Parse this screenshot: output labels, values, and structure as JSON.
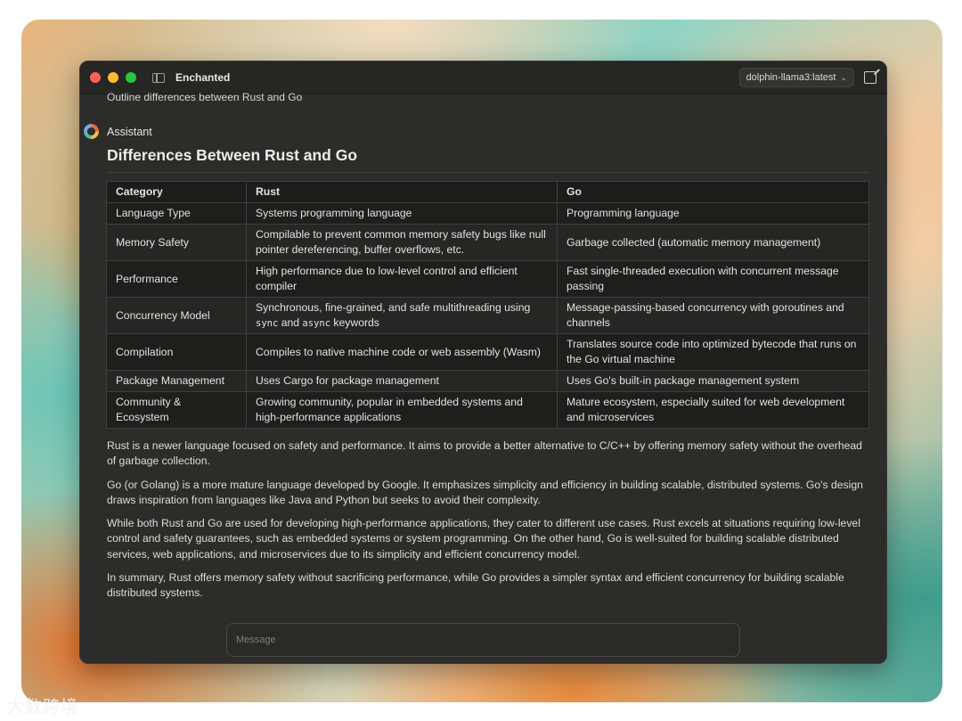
{
  "window": {
    "title": "Enchanted",
    "model": "dolphin-llama3:latest"
  },
  "conversation": {
    "previous_user_message": "Outline differences between Rust and Go",
    "assistant_label": "Assistant",
    "heading": "Differences Between Rust and Go",
    "table": {
      "headers": [
        "Category",
        "Rust",
        "Go"
      ],
      "rows": [
        {
          "category": "Language Type",
          "rust": "Systems programming language",
          "go": "Programming language"
        },
        {
          "category": "Memory Safety",
          "rust": "Compilable to prevent common memory safety bugs like null pointer dereferencing, buffer overflows, etc.",
          "go": "Garbage collected (automatic memory management)"
        },
        {
          "category": "Performance",
          "rust": "High performance due to low-level control and efficient compiler",
          "go": "Fast single-threaded execution with concurrent message passing"
        },
        {
          "category": "Concurrency Model",
          "rust_prefix": "Synchronous, fine-grained, and safe multithreading using",
          "rust_code1": "sync",
          "rust_and": "and",
          "rust_code2": "async",
          "rust_suffix": "keywords",
          "go": "Message-passing-based concurrency with goroutines and channels"
        },
        {
          "category": "Compilation",
          "rust": "Compiles to native machine code or web assembly (Wasm)",
          "go": "Translates source code into optimized bytecode that runs on the Go virtual machine"
        },
        {
          "category": "Package Management",
          "rust": "Uses Cargo for package management",
          "go": "Uses Go's built-in package management system"
        },
        {
          "category": "Community & Ecosystem",
          "rust": "Growing community, popular in embedded systems and high-performance applications",
          "go": "Mature ecosystem, especially suited for web development and microservices"
        }
      ]
    },
    "paragraphs": [
      "Rust is a newer language focused on safety and performance. It aims to provide a better alternative to C/C++ by offering memory safety without the overhead of garbage collection.",
      "Go (or Golang) is a more mature language developed by Google. It emphasizes simplicity and efficiency in building scalable, distributed systems. Go's design draws inspiration from languages like Java and Python but seeks to avoid their complexity.",
      "While both Rust and Go are used for developing high-performance applications, they cater to different use cases. Rust excels at situations requiring low-level control and safety guarantees, such as embedded systems or system programming. On the other hand, Go is well-suited for building scalable distributed services, web applications, and microservices due to its simplicity and efficient concurrency model.",
      "In summary, Rust offers memory safety without sacrificing performance, while Go provides a simpler syntax and efficient concurrency for building scalable distributed systems."
    ]
  },
  "composer": {
    "placeholder": "Message"
  },
  "watermark": "大数跨境"
}
